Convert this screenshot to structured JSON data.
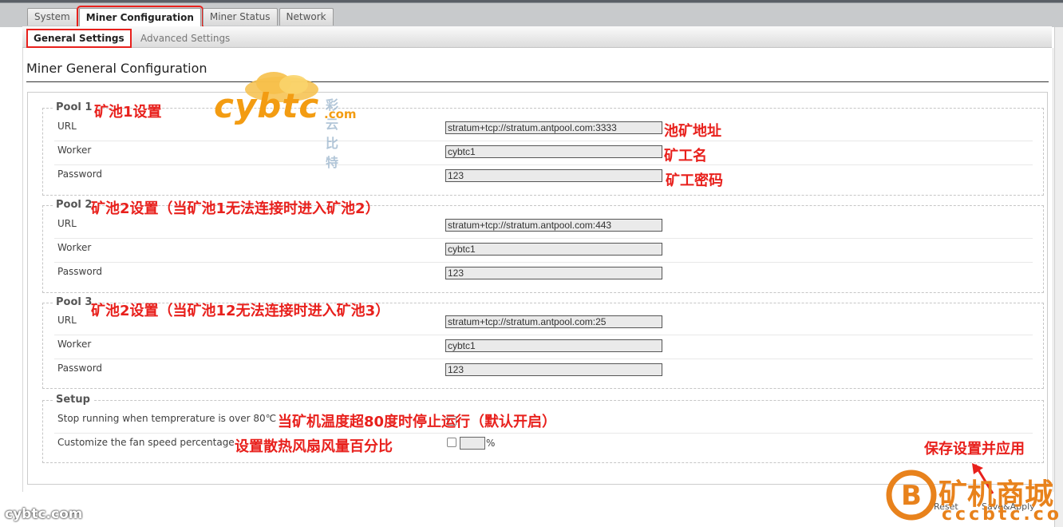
{
  "tabs": [
    "System",
    "Miner Configuration",
    "Miner Status",
    "Network"
  ],
  "subtabs": [
    "General Settings",
    "Advanced Settings"
  ],
  "page_title": "Miner General Configuration",
  "pools": [
    {
      "legend": "Pool 1",
      "url_label": "URL",
      "worker_label": "Worker",
      "password_label": "Password",
      "url": "stratum+tcp://stratum.antpool.com:3333",
      "worker": "cybtc1",
      "password": "123"
    },
    {
      "legend": "Pool 2",
      "url_label": "URL",
      "worker_label": "Worker",
      "password_label": "Password",
      "url": "stratum+tcp://stratum.antpool.com:443",
      "worker": "cybtc1",
      "password": "123"
    },
    {
      "legend": "Pool 3",
      "url_label": "URL",
      "worker_label": "Worker",
      "password_label": "Password",
      "url": "stratum+tcp://stratum.antpool.com:25",
      "worker": "cybtc1",
      "password": "123"
    }
  ],
  "setup": {
    "legend": "Setup",
    "stop_label": "Stop running when temprerature is over 80℃",
    "fan_label": "Customize the fan speed percentage",
    "percent": "%"
  },
  "annotations": {
    "pool1": "矿池1设置",
    "pool2": "矿池2设置（当矿池1无法连接时进入矿池2）",
    "pool3": "矿池2设置（当矿池12无法连接时进入矿池3）",
    "url": "池矿地址",
    "worker": "矿工名",
    "password": "矿工密码",
    "temp": "当矿机温度超80度时停止运行（默认开启）",
    "fan": "设置散热风扇风量百分比",
    "save": "保存设置并应用"
  },
  "buttons": {
    "reset": "Reset",
    "save": "Save&Apply"
  },
  "watermarks": {
    "logo_main": "cybtc",
    "logo_com": ".com",
    "logo_cn": "彩云比特",
    "bottom_left": "cybtc.com",
    "shop": "矿机商城",
    "shop_url": "cccbtc.com"
  },
  "colors": {
    "annotation": "#e8201c",
    "watermark": "#f39c12"
  }
}
